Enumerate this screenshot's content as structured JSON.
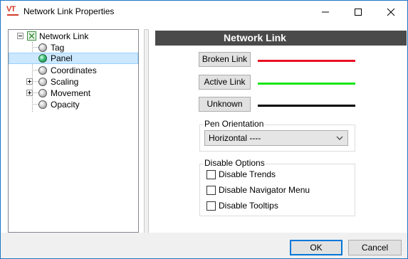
{
  "window": {
    "title": "Network Link Properties",
    "logo_text": "VT"
  },
  "tree": {
    "items": [
      {
        "label": "Network Link",
        "icon": "network-link-icon",
        "expander": "minus"
      },
      {
        "label": "Tag",
        "icon": "gray-ball-icon"
      },
      {
        "label": "Panel",
        "icon": "green-ball-icon",
        "selected": true
      },
      {
        "label": "Coordinates",
        "icon": "gray-ball-icon"
      },
      {
        "label": "Scaling",
        "icon": "gray-ball-icon",
        "expander": "plus"
      },
      {
        "label": "Movement",
        "icon": "gray-ball-icon",
        "expander": "plus"
      },
      {
        "label": "Opacity",
        "icon": "gray-ball-icon"
      }
    ]
  },
  "panel": {
    "header": "Network Link",
    "links": [
      {
        "label": "Broken Link",
        "color": "#e81123"
      },
      {
        "label": "Active Link",
        "color": "#16e616"
      },
      {
        "label": "Unknown",
        "color": "#000000"
      }
    ],
    "pen_orientation": {
      "title": "Pen Orientation",
      "selected": "Horizontal ----"
    },
    "disable_options": {
      "title": "Disable Options",
      "items": [
        {
          "label": "Disable Trends",
          "checked": false
        },
        {
          "label": "Disable Navigator Menu",
          "checked": false
        },
        {
          "label": "Disable Tooltips",
          "checked": false
        }
      ]
    }
  },
  "footer": {
    "ok_label": "OK",
    "cancel_label": "Cancel"
  }
}
